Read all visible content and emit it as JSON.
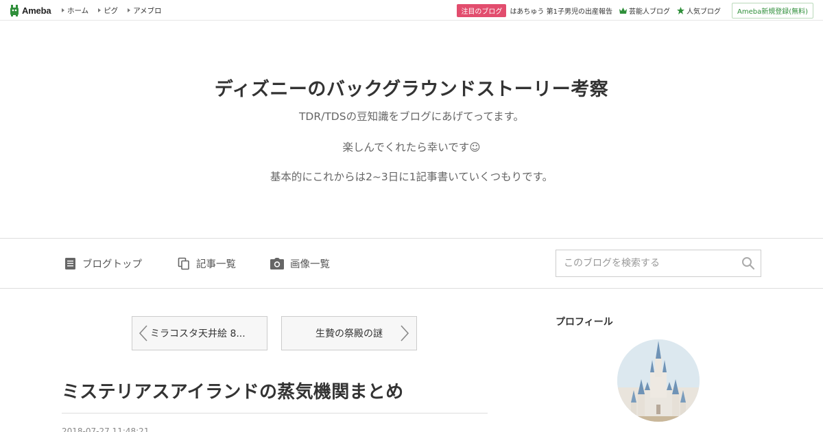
{
  "topbar": {
    "logo_text": "Ameba",
    "nav": [
      "ホーム",
      "ピグ",
      "アメブロ"
    ],
    "attention_badge": "注目のブログ",
    "attention_link": "はあちゅう 第1子男児の出産報告",
    "celeb_link": "芸能人ブログ",
    "popular_link": "人気ブログ",
    "signup": "Ameba新規登録(無料)"
  },
  "header": {
    "title": "ディズニーのバックグラウンドストーリー考察",
    "desc1": "TDR/TDSの豆知識をブログにあげてってます。",
    "desc2": "楽しんでくれたら幸いです☺",
    "desc3": "基本的にこれからは2~3日に1記事書いていくつもりです。"
  },
  "navband": {
    "blog_top": "ブログトップ",
    "article_list": "記事一覧",
    "image_list": "画像一覧",
    "search_placeholder": "このブログを検索する"
  },
  "pager": {
    "prev": "ミラコスタ天井絵 8...",
    "next": "生贄の祭殿の謎"
  },
  "article": {
    "title": "ミステリアスアイランドの蒸気機関まとめ",
    "date": "2018-07-27 11:48:21"
  },
  "sidebar": {
    "profile_heading": "プロフィール"
  },
  "colors": {
    "brand_green": "#2f8f3a",
    "attention_pink": "#e24d6e"
  }
}
